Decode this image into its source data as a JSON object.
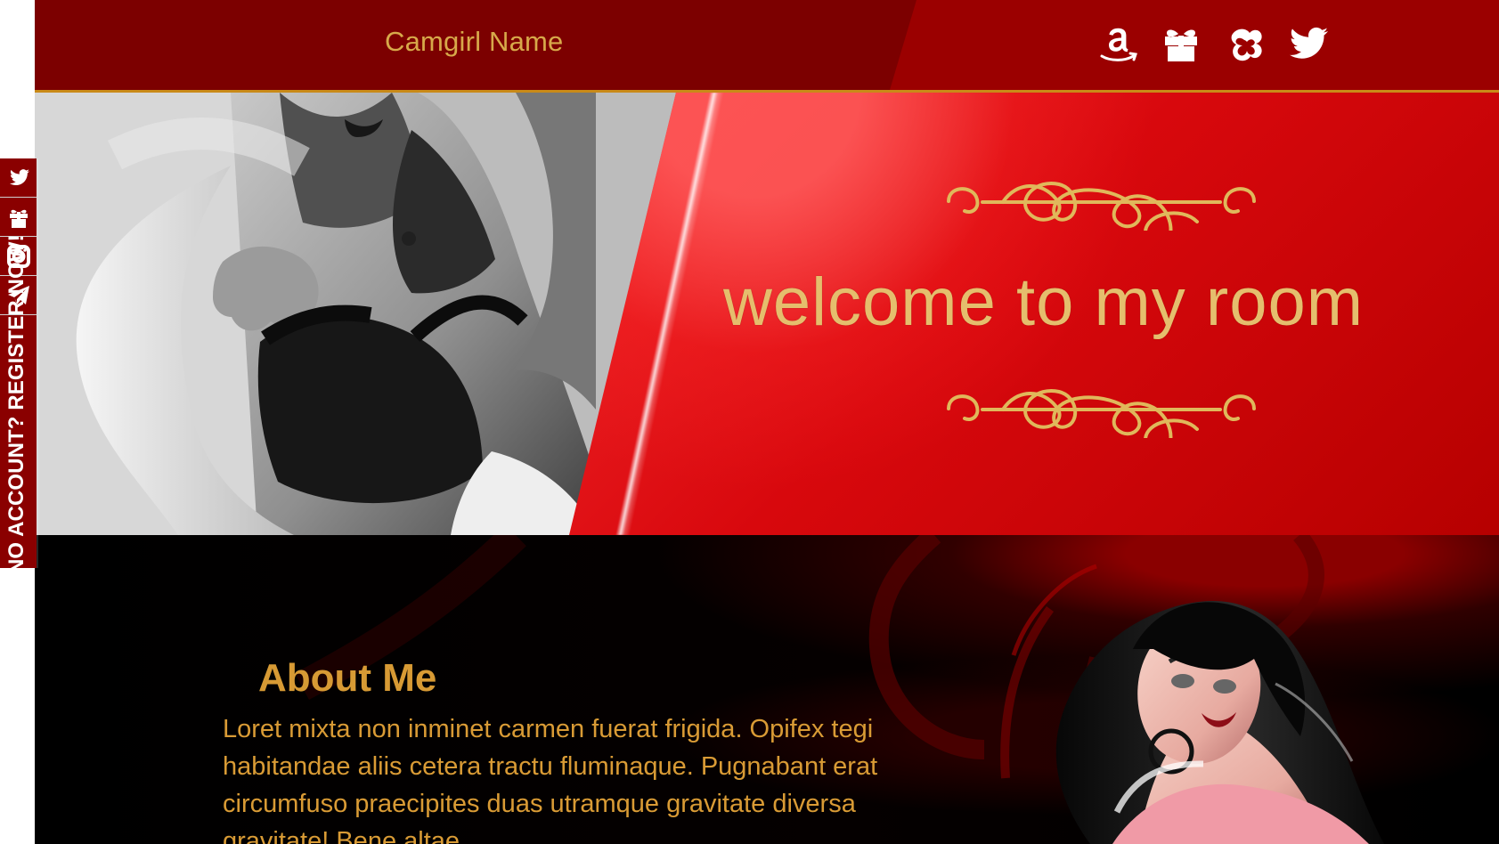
{
  "brand": {
    "name": "Camgirl Name"
  },
  "header": {
    "icons": [
      "amazon-icon",
      "gift-icon",
      "stripchat-icon",
      "twitter-icon"
    ]
  },
  "hero": {
    "headline": "welcome to my room"
  },
  "sidebar": {
    "icons": [
      "twitter-icon",
      "gift-icon",
      "instagram-icon",
      "telegram-icon"
    ],
    "register_label": "NO ACCOUNT? REGISTER NOW!"
  },
  "about": {
    "title": "About Me",
    "body": "Loret mixta non inminet carmen fuerat frigida. Opifex tegi habitandae aliis cetera tractu fluminaque. Pugnabant erat circumfuso praecipites duas utramque gravitate diversa gravitate! Bene altae"
  },
  "colors": {
    "header_red": "#9b0000",
    "header_dark_red": "#7c0000",
    "gold": "#d79a34",
    "accent_line": "#c98a18",
    "hero_red": "#d8080d",
    "side_tab": "#8a0000"
  }
}
